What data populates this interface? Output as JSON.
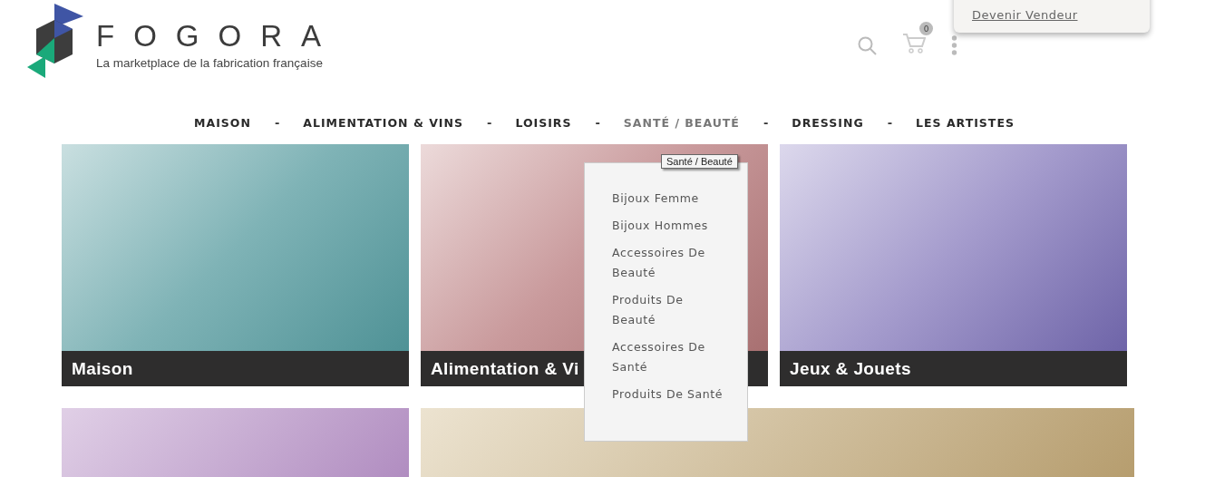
{
  "logo": {
    "name": "FOGORA",
    "tagline": "La marketplace de la fabrication française"
  },
  "account_popup": {
    "link": "Devenir Vendeur"
  },
  "cart": {
    "count": "0"
  },
  "nav": [
    {
      "label": "MAISON",
      "selected": false
    },
    {
      "label": "ALIMENTATION & VINS",
      "selected": false
    },
    {
      "label": "LOISIRS",
      "selected": false
    },
    {
      "label": "SANTÉ / BEAUTÉ",
      "selected": true
    },
    {
      "label": "DRESSING",
      "selected": false
    },
    {
      "label": "LES ARTISTES",
      "selected": false
    }
  ],
  "nav_separator": "-",
  "tooltip": "Santé / Beauté",
  "dropdown": [
    "Bijoux Femme",
    "Bijoux Hommes",
    "Accessoires De Beauté",
    "Produits De Beauté",
    "Accessoires De Santé",
    "Produits De Santé"
  ],
  "categories": [
    {
      "title": "Maison"
    },
    {
      "title": "Alimentation & Vi"
    },
    {
      "title": "Jeux & Jouets"
    }
  ]
}
